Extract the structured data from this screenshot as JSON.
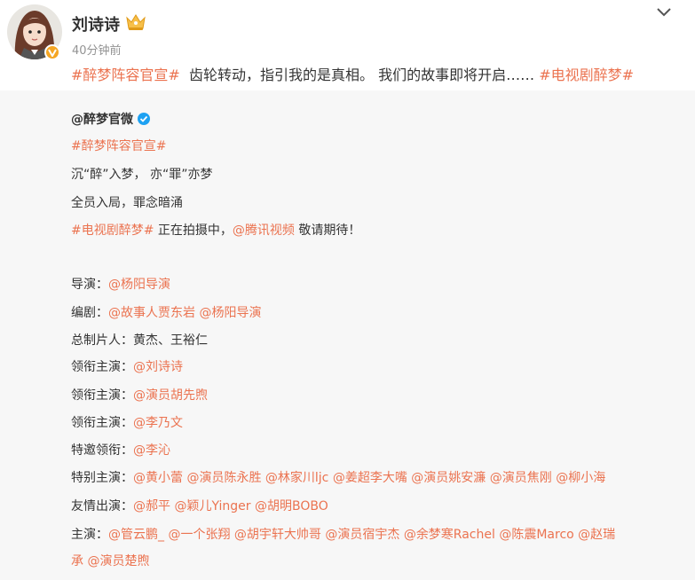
{
  "post": {
    "username": "刘诗诗",
    "timestamp": "40分钟前",
    "hashtag1": "#醉梦阵容官宣#",
    "text": "齿轮转动，指引我的是真相。 我们的故事即将开启……",
    "hashtag2": "#电视剧醉梦#"
  },
  "quote": {
    "author": "@醉梦官微",
    "hashtag": "#醉梦阵容官宣#",
    "line1": "沉“醉”入梦， 亦“罪”亦梦",
    "line2": "全员入局，罪念暗涌",
    "line3_tag": "#电视剧醉梦#",
    "line3_text": " 正在拍摄中，",
    "line3_mention": "@腾讯视频",
    "line3_end": " 敬请期待！",
    "credits": [
      {
        "label": "导演：",
        "mentions": [
          "@杨阳导演"
        ],
        "plain": ""
      },
      {
        "label": "编剧：",
        "mentions": [
          "@故事人贾东岩",
          "@杨阳导演"
        ],
        "plain": ""
      },
      {
        "label": "总制片人：",
        "mentions": [],
        "plain": "黄杰、王裕仁"
      },
      {
        "label": "领衔主演：",
        "mentions": [
          "@刘诗诗"
        ],
        "plain": ""
      },
      {
        "label": "领衔主演：",
        "mentions": [
          "@演员胡先煦"
        ],
        "plain": ""
      },
      {
        "label": "领衔主演：",
        "mentions": [
          "@李乃文"
        ],
        "plain": ""
      },
      {
        "label": "特邀领衔：",
        "mentions": [
          "@李沁"
        ],
        "plain": ""
      },
      {
        "label": "特别主演：",
        "mentions": [
          "@黄小蕾",
          "@演员陈永胜",
          "@林家川ljc",
          "@姜超李大嘴",
          "@演员姚安濂",
          "@演员焦刚",
          "@柳小海"
        ],
        "plain": ""
      },
      {
        "label": "友情出演：",
        "mentions": [
          "@郝平",
          "@颖儿Yinger",
          "@胡明BOBO"
        ],
        "plain": ""
      },
      {
        "label": "主演：",
        "mentions": [
          "@管云鹏_",
          "@一个张翔",
          "@胡宇轩大帅哥",
          "@演员宿宇杰",
          "@余梦寒Rachel",
          "@陈震Marco",
          "@赵瑞"
        ],
        "plain": ""
      },
      {
        "label": "",
        "mentions": [
          "承",
          "@演员楚煦"
        ],
        "plain": ""
      }
    ]
  },
  "colors": {
    "link": "#eb7350",
    "text": "#333333",
    "quote_bg": "#f7f7f7",
    "time": "#939393",
    "verified": "#1da1f2"
  },
  "icons": {
    "crown": "crown-icon",
    "chevron": "chevron-down-icon",
    "verified": "verified-icon",
    "vip": "vip-badge-icon"
  }
}
